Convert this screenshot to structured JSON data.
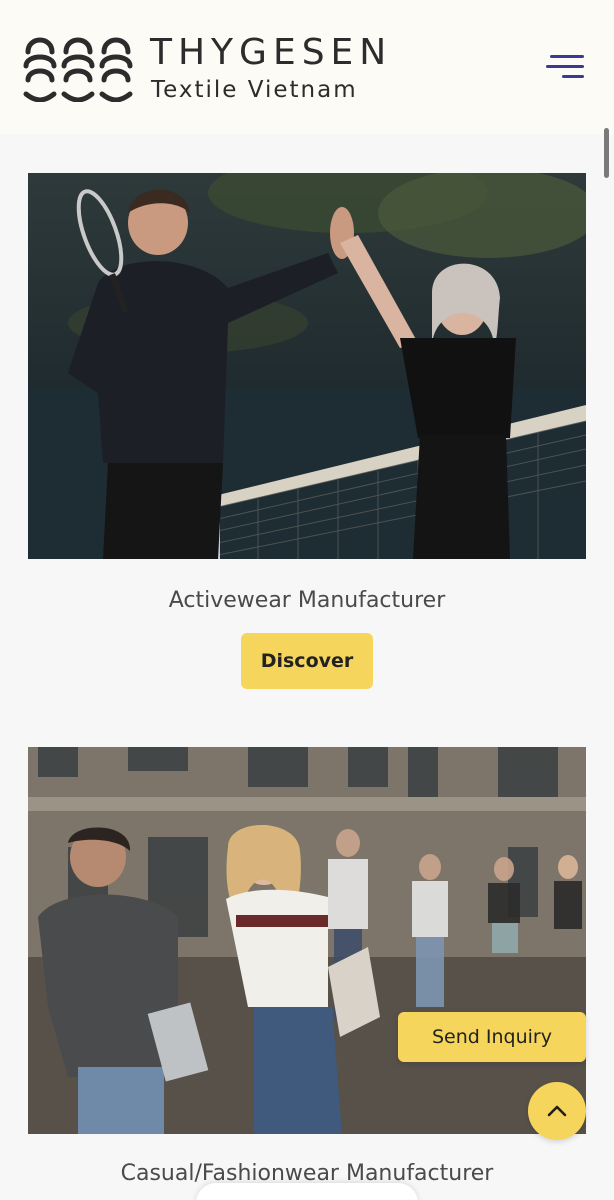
{
  "header": {
    "brand_name": "THYGESEN",
    "brand_sub": "Textile Vietnam",
    "logo_icon": "knot-logo-icon",
    "menu_icon": "hamburger-menu-icon"
  },
  "cards": [
    {
      "image_desc_icon": "photo-image",
      "title": "Activewear Manufacturer",
      "button_label": "Discover"
    },
    {
      "image_desc_icon": "photo-image",
      "title": "Casual/Fashionwear Manufacturer"
    }
  ],
  "floating": {
    "inquiry_label": "Send Inquiry",
    "top_icon": "chevron-up-icon"
  },
  "colors": {
    "accent": "#f6d55c",
    "header_bg": "#fdfbf6",
    "page_bg": "#f7f7f8",
    "menu_icon": "#3a3a92"
  }
}
